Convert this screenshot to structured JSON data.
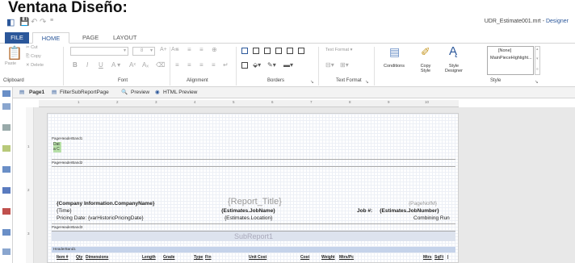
{
  "heading": "Ventana Diseño:",
  "app_title": {
    "file": "UDR_Estimate001.mrt",
    "separator": " - ",
    "designer": "Designer"
  },
  "tabs": [
    "FILE",
    "HOME",
    "PAGE",
    "LAYOUT"
  ],
  "clipboard": {
    "paste": "Paste",
    "cut": "Cut",
    "copy": "Copy",
    "delete": "Delete",
    "label": "Clipboard"
  },
  "font": {
    "size_value": "8",
    "label": "Font"
  },
  "alignment": {
    "label": "Alignment"
  },
  "borders": {
    "label": "Borders"
  },
  "text_format": {
    "value": "Text Format",
    "label": "Text Format"
  },
  "style": {
    "conditions": "Conditions",
    "copy_style": "Copy Style",
    "style_designer": "Style Designer",
    "label": "Style",
    "list": [
      "[None]",
      "MainPieceHighlight..."
    ]
  },
  "toolstrip": {
    "page1": "Page1",
    "filter_sub": "FilterSubReportPage",
    "preview": "Preview",
    "html_preview": "HTML Preview"
  },
  "ruler_numbers": [
    "1",
    "2",
    "3",
    "4",
    "5",
    "6",
    "7",
    "8",
    "9",
    "10"
  ],
  "ruler_v_numbers": [
    "1",
    "2",
    "3"
  ],
  "bands": {
    "header1": "PageHeaderBand1",
    "header1_tags": [
      "Dat",
      "a C"
    ],
    "header2": "PageHeaderBand2",
    "header3": "PageHeaderBand3",
    "headerband1": "HeaderBand1"
  },
  "report": {
    "company": "{Company Information.CompanyName}",
    "report_title": "{Report_Title}",
    "page_no": "{PageNofM}",
    "time": "{Time}",
    "job_name": "{Estimates.JobName}",
    "job_no_label": "Job #:",
    "job_number": "{Estimates.JobNumber}",
    "pricing": "Pricing Date: {varHistoricPricingDate}",
    "location": "{Estimates.Location}",
    "combining": "Combining Run",
    "subreport": "SubReport1"
  },
  "columns": [
    "Item #",
    "Qty",
    "Dimensions",
    "Length",
    "Grade",
    "Type",
    "Fin",
    "Unit Cost",
    "Cost",
    "Weight",
    "Mtrs/Pc",
    "Mtrs",
    "SqFt",
    "|"
  ]
}
